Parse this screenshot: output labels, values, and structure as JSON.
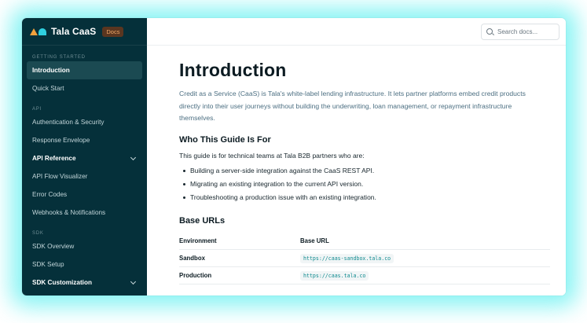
{
  "brand": {
    "name": "Tala CaaS",
    "badge": "Docs"
  },
  "search": {
    "placeholder": "Search docs..."
  },
  "sidebar": {
    "sections": [
      {
        "label": "GETTING STARTED",
        "items": [
          {
            "label": "Introduction",
            "active": true
          },
          {
            "label": "Quick Start"
          }
        ]
      },
      {
        "label": "API",
        "items": [
          {
            "label": "Authentication & Security"
          },
          {
            "label": "Response Envelope"
          },
          {
            "label": "API Reference",
            "expandable": true
          },
          {
            "label": "API Flow Visualizer"
          },
          {
            "label": "Error Codes"
          },
          {
            "label": "Webhooks & Notifications"
          }
        ]
      },
      {
        "label": "SDK",
        "items": [
          {
            "label": "SDK Overview"
          },
          {
            "label": "SDK Setup"
          },
          {
            "label": "SDK Customization",
            "expandable": true
          }
        ]
      }
    ]
  },
  "page": {
    "title": "Introduction",
    "lead": "Credit as a Service (CaaS) is Tala's white-label lending infrastructure. It lets partner platforms embed credit products directly into their user journeys without building the underwriting, loan management, or repayment infrastructure themselves.",
    "who_heading": "Who This Guide Is For",
    "who_intro": "This guide is for technical teams at Tala B2B partners who are:",
    "who_bullets": [
      "Building a server-side integration against the CaaS REST API.",
      "Migrating an existing integration to the current API version.",
      "Troubleshooting a production issue with an existing integration."
    ],
    "urls_heading": "Base URLs",
    "urls_table": {
      "headers": [
        "Environment",
        "Base URL"
      ],
      "rows": [
        {
          "environment": "Sandbox",
          "url": "https://caas-sandbox.tala.co"
        },
        {
          "environment": "Production",
          "url": "https://caas.tala.co"
        }
      ]
    }
  },
  "colors": {
    "sidebar_bg": "#05303a",
    "active_item_bg": "#1b4a52",
    "badge_bg": "#5a3620",
    "badge_text": "#f0a868",
    "logo_orange": "#f2a13c",
    "logo_cyan": "#2fd0e0",
    "code_text": "#0f8a8f",
    "glow": "#5ef0f0"
  }
}
